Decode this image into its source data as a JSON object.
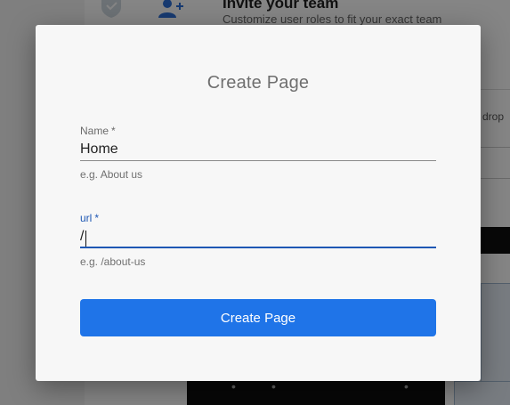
{
  "background": {
    "header_title": "Invite your team",
    "header_subtitle": "Customize user roles to fit your exact team",
    "side_text": "drop",
    "icons": [
      "shield-icon",
      "add-user-icon"
    ]
  },
  "dialog": {
    "title": "Create Page",
    "fields": {
      "name": {
        "label": "Name",
        "required_mark": "*",
        "value": "Home",
        "hint": "e.g. About us"
      },
      "url": {
        "label": "url",
        "required_mark": "*",
        "value": "/",
        "hint": "e.g. /about-us"
      }
    },
    "submit_label": "Create Page"
  },
  "colors": {
    "accent": "#1f74e8",
    "focus": "#1f58b4",
    "dialog_bg": "#f7f7f7"
  }
}
